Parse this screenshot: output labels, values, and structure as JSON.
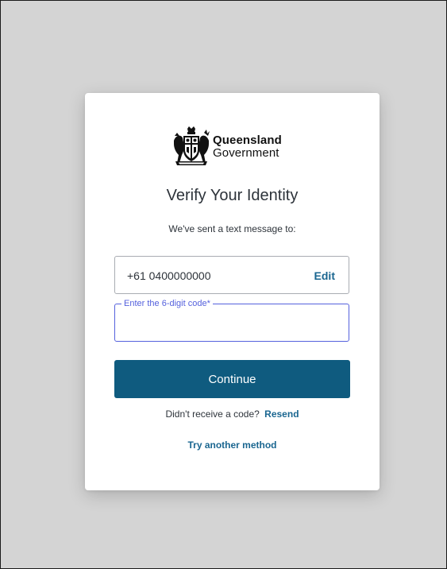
{
  "brand": {
    "line1": "Queensland",
    "line2": "Government"
  },
  "title": "Verify Your Identity",
  "subtitle": "We've sent a text message to:",
  "phone": {
    "value": "+61 0400000000",
    "edit_label": "Edit"
  },
  "code_field": {
    "label": "Enter the 6-digit code*",
    "value": ""
  },
  "continue_label": "Continue",
  "resend": {
    "prompt": "Didn't receive a code?",
    "link_label": "Resend"
  },
  "try_another_label": "Try another method",
  "colors": {
    "background": "#d4d4d4",
    "card": "#ffffff",
    "primary_button": "#0f5b7f",
    "link": "#1a6690",
    "focus_border": "#5561dd",
    "text": "#2d333a"
  }
}
